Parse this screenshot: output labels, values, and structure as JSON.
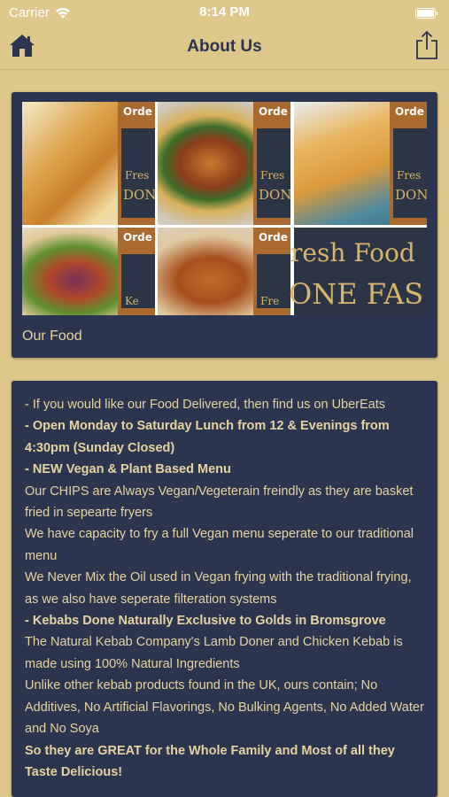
{
  "status": {
    "carrier": "Carrier",
    "time": "8:14 PM"
  },
  "nav": {
    "title": "About Us"
  },
  "food_card": {
    "caption": "Our Food",
    "promo_word": "Orde",
    "promo_fresh": "Fres",
    "promo_done": "DON",
    "promo_kebab": "Ke",
    "promo_fre2": "Fre",
    "promo_fresh_food": "resh Food",
    "promo_done_fast": "ONE FAS"
  },
  "info": {
    "lines": [
      "- If you would like our Food Delivered, then find us on UberEats",
      "- Open Monday to Saturday Lunch from 12 & Evenings from 4:30pm (Sunday Closed)",
      "- NEW Vegan & Plant Based Menu",
      "Our CHIPS are Always Vegan/Vegeterain freindly as they are basket fried in sepearte fryers",
      "We have capacity to fry a full Vegan menu seperate to our traditional menu",
      "We Never Mix the Oil used in Vegan frying with the traditional frying, as we also have seperate filteration systems",
      "- Kebabs Done Naturally Exclusive to Golds in Bromsgrove",
      "The Natural Kebab Company's Lamb Doner and Chicken Kebab is made using 100% Natural Ingredients",
      "Unlike other kebab products found in the UK, ours contain; No Additives, No Artificial Flavorings, No Bulking Agents, No Added Water and No Soya",
      "So they are GREAT for the Whole Family and Most of all they Taste Delicious!"
    ]
  },
  "colors": {
    "background": "#dfc78b",
    "card": "#2c3550",
    "text": "#e6d3a0",
    "title": "#2c3550"
  },
  "icons": {
    "home": "home-icon",
    "share": "share-icon",
    "wifi": "wifi-icon",
    "battery": "battery-icon"
  }
}
